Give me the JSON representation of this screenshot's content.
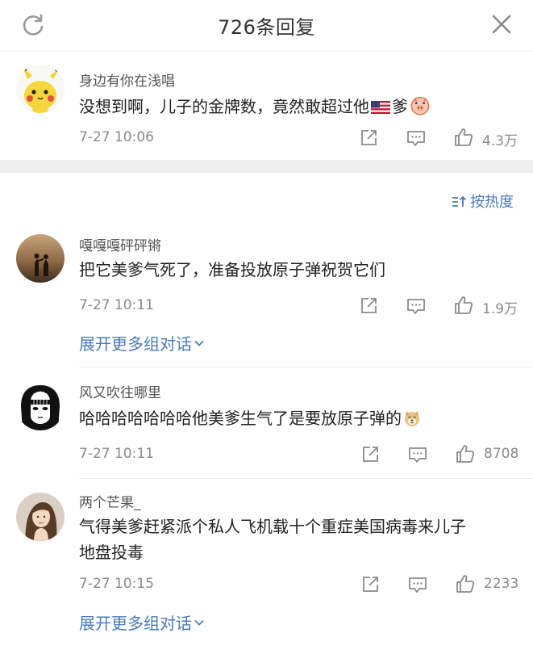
{
  "header": {
    "title": "726条回复"
  },
  "sort": {
    "label": "按热度"
  },
  "top_comment": {
    "username": "身边有你在浅唱",
    "text_before_flag": "没想到啊，儿子的金牌数，竟然敢超过他",
    "text_after_flag": "爹",
    "time": "7-27 10:06",
    "likes": "4.3万"
  },
  "replies": [
    {
      "username": "嘎嘎嘎砰砰锵",
      "text": "把它美爹气死了，准备投放原子弹祝贺它们",
      "time": "7-27 10:11",
      "likes": "1.9万",
      "expand": "展开更多组对话"
    },
    {
      "username": "风又吹往哪里",
      "text": "哈哈哈哈哈哈哈他美爹生气了是要放原子弹的",
      "time": "7-27 10:11",
      "likes": "8708"
    },
    {
      "username": "两个芒果_",
      "text_line1": "气得美爹赶紧派个私人飞机载十个重症美国病毒来儿子",
      "text_line2": "地盘投毒",
      "time": "7-27 10:15",
      "likes": "2233",
      "expand": "展开更多组对话"
    }
  ],
  "icons": [
    "refresh-icon",
    "close-icon",
    "share-icon",
    "comment-icon",
    "like-icon",
    "sort-icon",
    "chevron-down-icon",
    "us-flag-icon",
    "piggy-emoji-icon",
    "doge-emoji-icon"
  ],
  "colors": {
    "link": "#4a7bb7",
    "meta": "#8a8a8a",
    "divider": "#efefef"
  }
}
